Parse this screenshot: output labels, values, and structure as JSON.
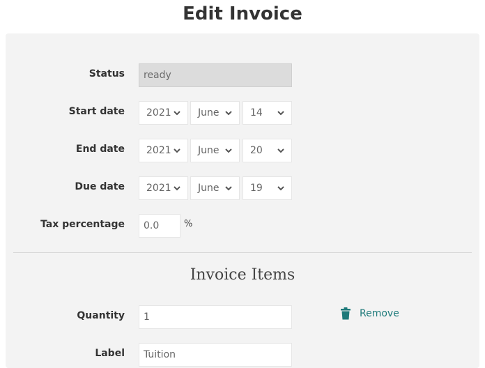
{
  "page": {
    "title": "Edit Invoice"
  },
  "form": {
    "status": {
      "label": "Status",
      "value": "ready"
    },
    "start_date": {
      "label": "Start date",
      "year": "2021",
      "month": "June",
      "day": "14"
    },
    "end_date": {
      "label": "End date",
      "year": "2021",
      "month": "June",
      "day": "20"
    },
    "due_date": {
      "label": "Due date",
      "year": "2021",
      "month": "June",
      "day": "19"
    },
    "tax": {
      "label": "Tax percentage",
      "value": "0.0",
      "unit": "%"
    }
  },
  "items": {
    "title": "Invoice Items",
    "quantity": {
      "label": "Quantity",
      "value": "1"
    },
    "item_label": {
      "label": "Label",
      "value": "Tuition"
    },
    "remove_label": "Remove"
  },
  "colors": {
    "accent": "#1d7a7a",
    "card_bg": "#f3f3f3",
    "disabled_bg": "#dcdcdc"
  }
}
